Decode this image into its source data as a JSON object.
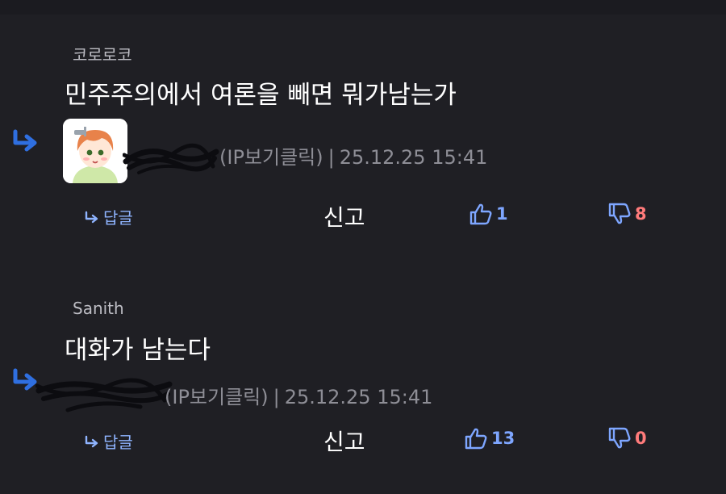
{
  "comments": [
    {
      "author": "코로로코",
      "body": "민주주의에서 여론을 빼면 뭐가남는가",
      "reply": {
        "ip_label": "(IP보기클릭)",
        "timestamp": "25.12.25 15:41"
      },
      "actions": {
        "reply_label": "답글",
        "report_label": "신고",
        "upvotes": "1",
        "downvotes": "8"
      }
    },
    {
      "author": "Sanith",
      "body": "대화가 남는다",
      "reply": {
        "ip_label": "(IP보기클릭)",
        "timestamp": "25.12.25 15:41"
      },
      "actions": {
        "reply_label": "답글",
        "report_label": "신고",
        "upvotes": "13",
        "downvotes": "0"
      }
    }
  ],
  "colors": {
    "background": "#1f1f24",
    "accent_blue": "#7ea6ff",
    "downvote_red": "#ff7b7b",
    "meta_gray": "#8e8e96"
  },
  "icons": [
    "reply-arrow-icon",
    "thumbs-up-icon",
    "thumbs-down-icon",
    "avatar"
  ]
}
